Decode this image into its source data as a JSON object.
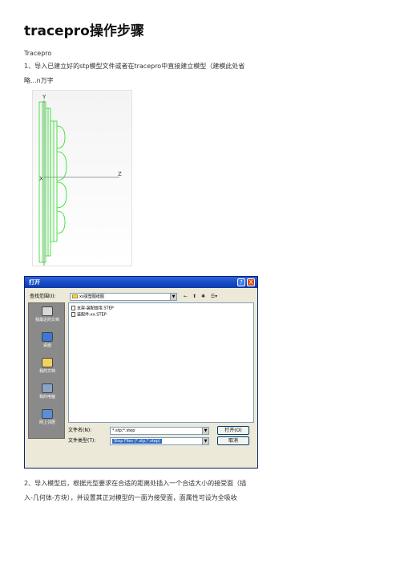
{
  "title": "tracepro操作步骤",
  "paragraphs": {
    "p1": "Tracepro",
    "p2a": "1、导入已建立好的stp模型文件或者在tracepro中直接建立模型（建模此处省",
    "p2b": "略...n万字",
    "p3a": "2、导入模型后，根据光型要求在合适的距离处插入一个合适大小的接受面（插",
    "p3b": "入-几何体-方块），并设置其正对模型的一面为接受面，面属性可设为全吸收"
  },
  "cad_figure": {
    "axis_y": "Y",
    "axis_x": "X",
    "axis_z": "Z",
    "line_color": "#22dd22"
  },
  "dialog": {
    "title": "打开",
    "help_btn": "?",
    "close_btn": "X",
    "lookin_label": "查找范围(I):",
    "lookin_value": "xx拔塑图纸图",
    "toolbar_icons": [
      "back-icon",
      "up-folder-icon",
      "new-folder-icon",
      "view-menu-icon"
    ],
    "places": [
      {
        "label": "我最近的文档",
        "color": "#d8d8d8"
      },
      {
        "label": "桌面",
        "color": "#3b78d8"
      },
      {
        "label": "我的文档",
        "color": "#f3d160"
      },
      {
        "label": "我的电脑",
        "color": "#8aa4c8"
      },
      {
        "label": "网上邻居",
        "color": "#5b8ed6"
      }
    ],
    "files": [
      "支架-装配提用.STEP",
      "装配件-xx.STEP"
    ],
    "filename_label": "文件名(N):",
    "filename_value": "*.stp;*.step",
    "filetype_label": "文件类型(T):",
    "filetype_value": "Step Files (*.stp;*.step)",
    "open_btn": "打开(O)",
    "cancel_btn": "取消"
  }
}
